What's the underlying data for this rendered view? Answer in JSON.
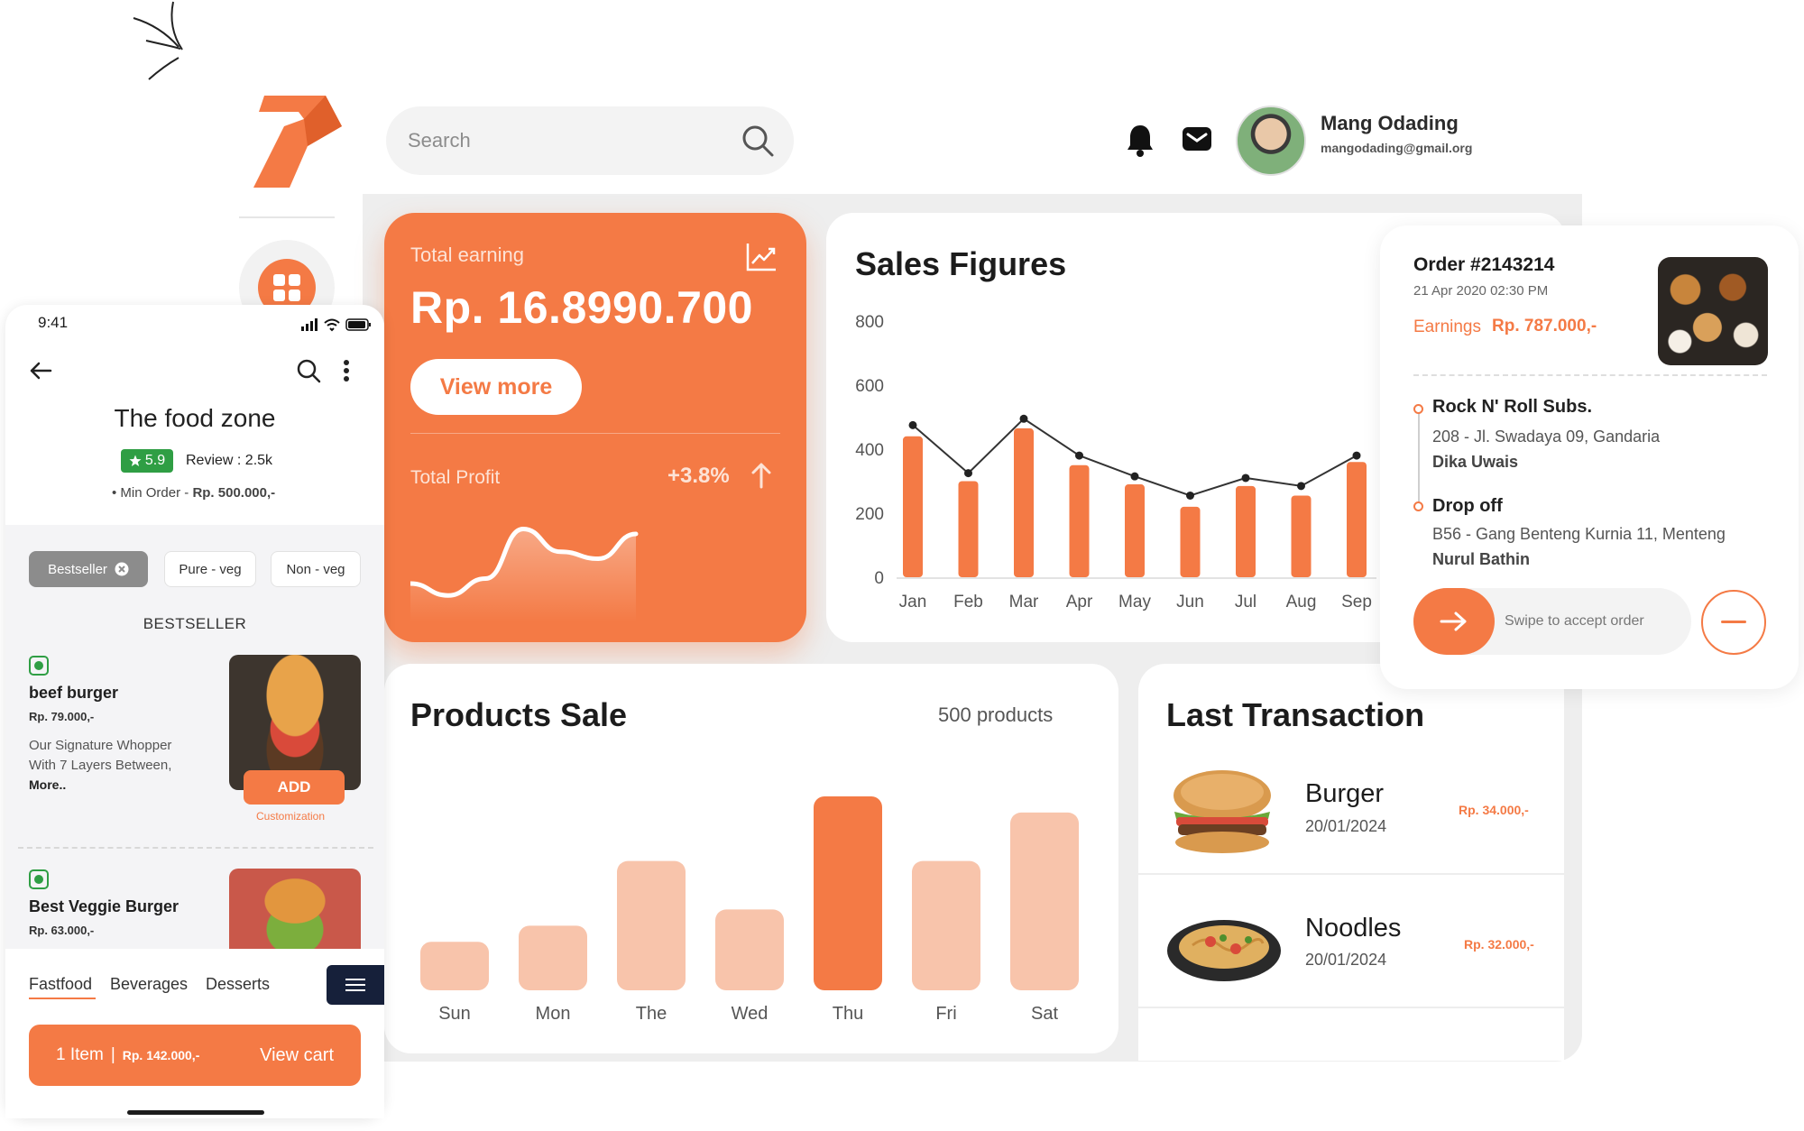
{
  "colors": {
    "accent": "#f47a45",
    "accent_light": "#f8c4ab",
    "veg_green": "#2f9e44",
    "dark_navy": "#16203a"
  },
  "header": {
    "search_placeholder": "Search",
    "user": {
      "name": "Mang Odading",
      "email": "mangodading@gmail.org"
    },
    "icons": [
      "search-icon",
      "bell-icon",
      "mail-icon"
    ]
  },
  "earning_card": {
    "label": "Total earning",
    "value": "Rp. 16.8990.700",
    "button": "View more",
    "profit_label": "Total Profit",
    "profit_value": "+3.8%",
    "sparkline": [
      0.3,
      0.18,
      0.35,
      0.85,
      0.62,
      0.55,
      0.8
    ]
  },
  "sales_card": {
    "title": "Sales Figures"
  },
  "products_card": {
    "title": "Products Sale",
    "count": "500 products"
  },
  "transactions": {
    "title": "Last Transaction",
    "items": [
      {
        "name": "Burger",
        "date": "20/01/2024",
        "price": "Rp. 34.000,-"
      },
      {
        "name": "Noodles",
        "date": "20/01/2024",
        "price": "Rp. 32.000,-"
      }
    ]
  },
  "order": {
    "title": "Order #2143214",
    "date": "21 Apr 2020 02:30 PM",
    "earnings_label": "Earnings",
    "earnings_value": "Rp. 787.000,-",
    "pickup": {
      "name": "Rock N' Roll Subs.",
      "address": "208 - Jl. Swadaya 09, Gandaria",
      "person": "Dika Uwais"
    },
    "dropoff": {
      "name": "Drop off",
      "address": "B56 - Gang Benteng Kurnia 11, Menteng",
      "person": "Nurul Bathin"
    },
    "swipe_text": "Swipe to accept order"
  },
  "mobile": {
    "time": "9:41",
    "title": "The food zone",
    "rating": "5.9",
    "review": "Review : 2.5k",
    "min_order_label": "Min Order -",
    "min_order_value": "Rp. 500.000,-",
    "chips": [
      "Bestseller",
      "Pure - veg",
      "Non - veg"
    ],
    "section_heading": "BESTSELLER",
    "items": [
      {
        "name": "beef burger",
        "price": "Rp. 79.000,-",
        "desc": "Our Signature Whopper With 7 Layers Between,",
        "more": "More..",
        "add": "ADD",
        "custom": "Customization"
      },
      {
        "name": "Best Veggie Burger",
        "price": "Rp. 63.000,-"
      }
    ],
    "tabs": [
      "Fastfood",
      "Beverages",
      "Desserts"
    ],
    "cart": {
      "count": "1 Item",
      "sep": "|",
      "total": "Rp. 142.000,-",
      "cta": "View cart"
    }
  },
  "chart_data": [
    {
      "type": "bar",
      "title": "Sales Figures",
      "categories": [
        "Jan",
        "Feb",
        "Mar",
        "Apr",
        "May",
        "Jun",
        "Jul",
        "Aug",
        "Sep"
      ],
      "series": [
        {
          "values": [
            440,
            300,
            465,
            350,
            290,
            220,
            285,
            255,
            360
          ]
        }
      ],
      "line_overlay": [
        475,
        325,
        495,
        380,
        315,
        255,
        310,
        285,
        380
      ],
      "ylim": [
        0,
        800
      ],
      "yticks": [
        0,
        200,
        400,
        600,
        800
      ],
      "grid": false
    },
    {
      "type": "bar",
      "title": "Products Sale",
      "categories": [
        "Sun",
        "Mon",
        "The",
        "Wed",
        "Thu",
        "Fri",
        "Sat"
      ],
      "values": [
        15,
        20,
        40,
        25,
        60,
        40,
        55
      ],
      "highlight": "Thu",
      "ylim": [
        0,
        60
      ]
    }
  ]
}
